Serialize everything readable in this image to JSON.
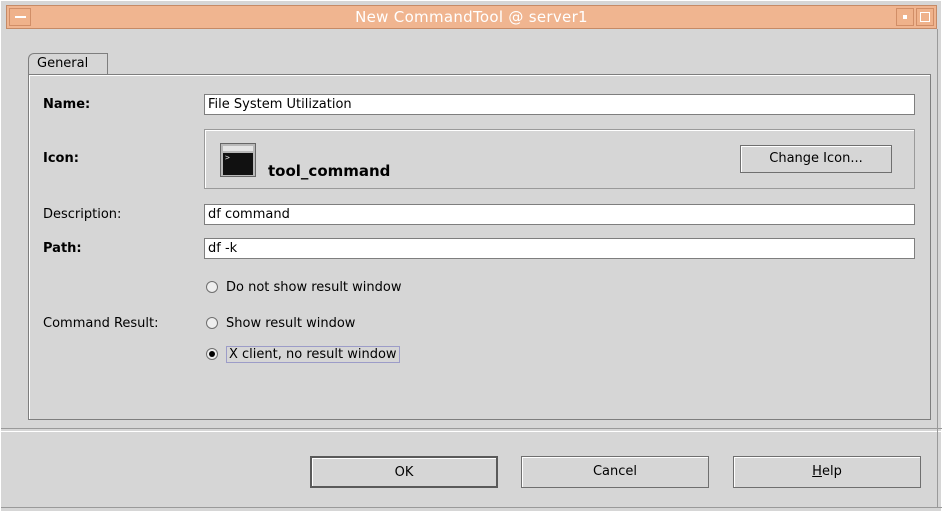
{
  "window": {
    "title": "New CommandTool @ server1"
  },
  "tabs": [
    {
      "label": "General"
    }
  ],
  "form": {
    "name_label": "Name:",
    "name_value": "File System Utilization",
    "icon_label": "Icon:",
    "icon_name": "tool_command",
    "icon_semantic": "terminal-window-icon",
    "change_icon_label": "Change Icon...",
    "description_label": "Description:",
    "description_value": "df command",
    "path_label": "Path:",
    "path_value": "df -k",
    "command_result_label": "Command Result:",
    "result_options": [
      {
        "label": "Do not show result window",
        "selected": false
      },
      {
        "label": "Show result window",
        "selected": false
      },
      {
        "label": "X client, no result window",
        "selected": true
      }
    ]
  },
  "buttons": {
    "ok": "OK",
    "cancel": "Cancel",
    "help_underlined": "H",
    "help_rest": "elp"
  }
}
